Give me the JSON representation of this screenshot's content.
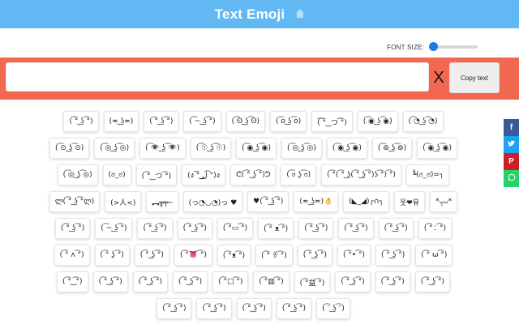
{
  "header": {
    "title": "Text Emoji",
    "logo_icon": "hand-icon"
  },
  "controls": {
    "font_size_label": "FONT SIZE:",
    "font_size_level": 0.08
  },
  "input": {
    "value": "",
    "placeholder": ""
  },
  "buttons": {
    "clear_label": "X",
    "copy_label": "Copy text"
  },
  "colors": {
    "header": "#62b8f2",
    "input_band": "#f2674f",
    "slider": "#1e7ae6",
    "facebook": "#3b5998",
    "twitter": "#1da1f2",
    "pinterest": "#cb2027",
    "whatsapp": "#25d366"
  },
  "emojis": [
    "( ͡° ͜ʖ ͡°)",
    "(≖ ͜ʖ≖)",
    "( ͠° ͟ʖ ͡°)",
    "( ͡~ ͜ʖ ͡°)",
    "( ͡ʘ ͜ʖ ͡ʘ)",
    "( ͡o ͜ʖ ͡o)",
    "(͡ ͡° ͜ つ ͡͡°)",
    "( ͡◉ ͜ʖ ͡◉)",
    "( ͡◔ ͜ʖ ͡◔)",
    "( ͡⊙ ͜ʖ ͡⊙)",
    "( ͡◎ ͜ʖ ͡◎)",
    "( ͡👁️ ͜ʖ ͡👁️)",
    "( ͡☉ ͜ʖ ͡☉)",
    "( ͡◉ ͜ʖ ͡◉)",
    "( ͡◎ ͜ʖ ͡◎)",
    "( ͡◉ ͜ʖ ͡◉)",
    "( ͡⊚ ͜ʖ ͡⊚)",
    "( ͡◉ ͜ʖ ͡◉)",
    "( ͡◎ ͜ʖ ͡◎)",
    "(ಠ_ಠ)",
    "( ͡° ͜ つ ͡°)",
    "(ง ͠° ͟ل͜ ͡°)ง",
    "ᕦ( ͡° ͜ʖ ͡°)ᕤ",
    "( ͡ಠ ʖ̯ ͡ಠ)",
    "( ͡°( ͡° ͜ʖ( ͡° ͜ʖ ͡°)ʖ ͡°) ͡°)",
    "╚(ಠ_ಠ)=┐",
    "ლ( ͡° ͜ʖ ͡°ლ)",
    "(>人<)",
    "︻╦╤─",
    "(っ◔◡◔)っ ♥",
    "♥( ͡° ͜ʖ ͡°)",
    "(≖ ͜ʖ≖)👌",
    "(◣_◢)┌∩┐",
    "웃❤유",
    "*ᴗ̩̩ᴗ*",
    "( ͡° ͜ʖ ͡°)",
    "( ͡~ ͜ʖ ͡°)",
    "( ͡° ͜ʖ ͡°)",
    "( ͡° ͜ʖ ͡°)",
    "( ͡°▭ ͡°)",
    "( ͡° ᴥ ͡°)",
    "( ͡° ͜ʖ ͡°)",
    "( ͡° ͜ʖ ͡°)",
    "( ͡° ͜ʖ ͡°)",
    "( ͡°⍘ ͡°)",
    "( ͡° ʌ ͡°)",
    "( ͡° ʖ̯ ͡°)",
    "( ͡° ͜ʖ ͡°)",
    "( ͡°👅 ͡°)",
    "( ͡°ᴥ ͡°)",
    "( ͡° ꈊ ͡°)",
    "( ͡° ͜ʖ ͡°)",
    "( ͡°• ͡°)",
    "( ͡° ͜ʖ ͡°)",
    "( ͡° ω ͡°)",
    "( ͡° ͜ ͡°)",
    "( ͡° ͜ʖ ͡°)",
    "( ͡° ͜ʖ ͡°)",
    "( ͡° ͜ʖ ͡°)",
    "( ͡°□ ͡°)",
    "( ͡°▥ ͡°)",
    "( ͡°益 ͡°)",
    "( ͡° ͜ʖ ͡°)",
    "( ͡° ͜ʖ ͡°)",
    "( ͡° ͜ʖ ͡°)",
    "( ͡° ͜ʖ ͡°)",
    "( ͡° ͜ʖ ͡°)",
    "( ͡° ͜ʖ ͡°)",
    "( ͡° ͜ʖ ͡°)",
    "( ͡ᵔ ͜ʖ ͡ᵔ)"
  ]
}
